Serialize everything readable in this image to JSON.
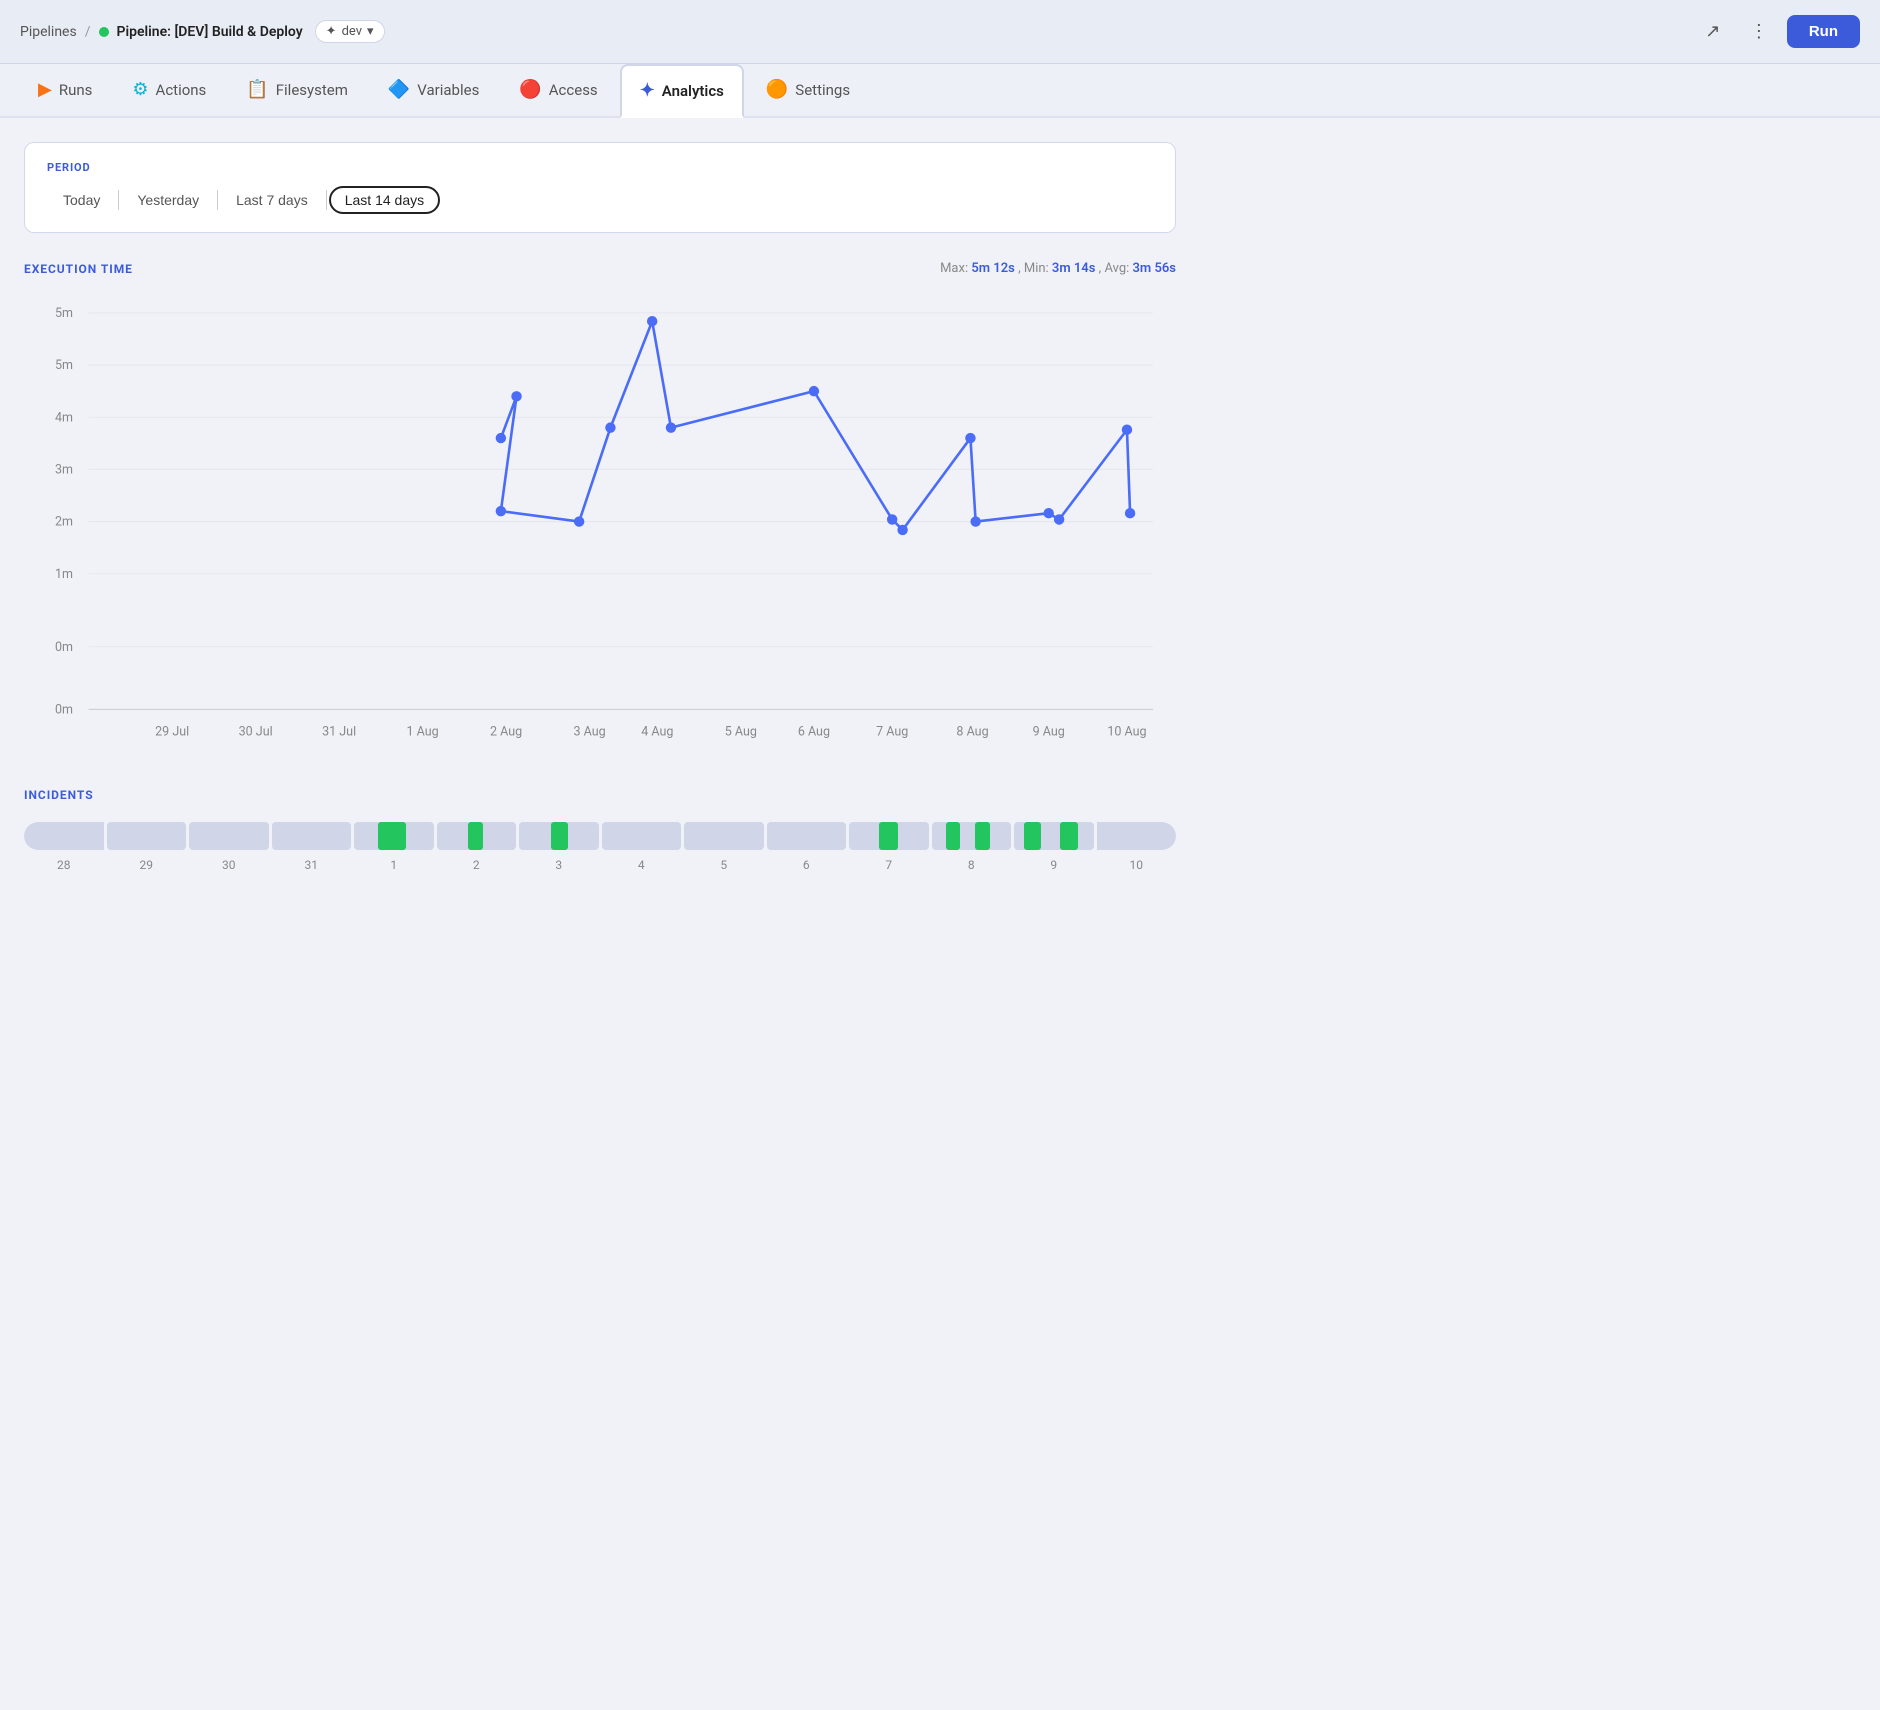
{
  "header": {
    "breadcrumb_link": "Pipelines",
    "separator": "/",
    "pipeline_name": "Pipeline: [DEV] Build & Deploy",
    "branch": "dev",
    "run_label": "Run"
  },
  "tabs": [
    {
      "id": "runs",
      "label": "Runs",
      "icon": "▶"
    },
    {
      "id": "actions",
      "label": "Actions",
      "icon": "⚙"
    },
    {
      "id": "filesystem",
      "label": "Filesystem",
      "icon": "📋"
    },
    {
      "id": "variables",
      "label": "Variables",
      "icon": "🔷"
    },
    {
      "id": "access",
      "label": "Access",
      "icon": "🔴"
    },
    {
      "id": "analytics",
      "label": "Analytics",
      "icon": "✦",
      "active": true
    },
    {
      "id": "settings",
      "label": "Settings",
      "icon": "🟠"
    }
  ],
  "period": {
    "label": "PERIOD",
    "options": [
      {
        "id": "today",
        "label": "Today"
      },
      {
        "id": "yesterday",
        "label": "Yesterday"
      },
      {
        "id": "last7",
        "label": "Last 7 days"
      },
      {
        "id": "last14",
        "label": "Last 14 days",
        "active": true
      }
    ]
  },
  "execution_time": {
    "title": "EXECUTION TIME",
    "stats_prefix_max": "Max:",
    "max_val": "5m 12s",
    "stats_prefix_min": "Min:",
    "min_val": "3m 14s",
    "stats_prefix_avg": "Avg:",
    "avg_val": "3m 56s",
    "x_labels": [
      "29 Jul",
      "30 Jul",
      "31 Jul",
      "1 Aug",
      "2 Aug",
      "3 Aug",
      "4 Aug",
      "5 Aug",
      "6 Aug",
      "7 Aug",
      "8 Aug",
      "9 Aug",
      "10 Aug"
    ],
    "y_labels": [
      "5m",
      "5m",
      "4m",
      "3m",
      "2m",
      "1m",
      "0m",
      "0m"
    ]
  },
  "incidents": {
    "title": "INCIDENTS",
    "x_labels": [
      "28",
      "29",
      "30",
      "31",
      "1",
      "2",
      "3",
      "4",
      "5",
      "6",
      "7",
      "8",
      "9",
      "10"
    ],
    "segments": [
      {
        "has_green": false,
        "positions": []
      },
      {
        "has_green": false,
        "positions": []
      },
      {
        "has_green": false,
        "positions": []
      },
      {
        "has_green": false,
        "positions": []
      },
      {
        "has_green": true,
        "positions": [
          {
            "left": "35%",
            "width": "30%"
          }
        ]
      },
      {
        "has_green": true,
        "positions": [
          {
            "left": "40%",
            "width": "15%"
          }
        ]
      },
      {
        "has_green": true,
        "positions": [
          {
            "left": "45%",
            "width": "20%"
          }
        ]
      },
      {
        "has_green": false,
        "positions": []
      },
      {
        "has_green": false,
        "positions": []
      },
      {
        "has_green": false,
        "positions": []
      },
      {
        "has_green": true,
        "positions": [
          {
            "left": "40%",
            "width": "20%"
          }
        ]
      },
      {
        "has_green": true,
        "positions": [
          {
            "left": "20%",
            "width": "15%"
          },
          {
            "left": "55%",
            "width": "15%"
          }
        ]
      },
      {
        "has_green": true,
        "positions": [
          {
            "left": "15%",
            "width": "20%"
          },
          {
            "left": "60%",
            "width": "20%"
          }
        ]
      },
      {
        "has_green": false,
        "positions": []
      }
    ]
  }
}
